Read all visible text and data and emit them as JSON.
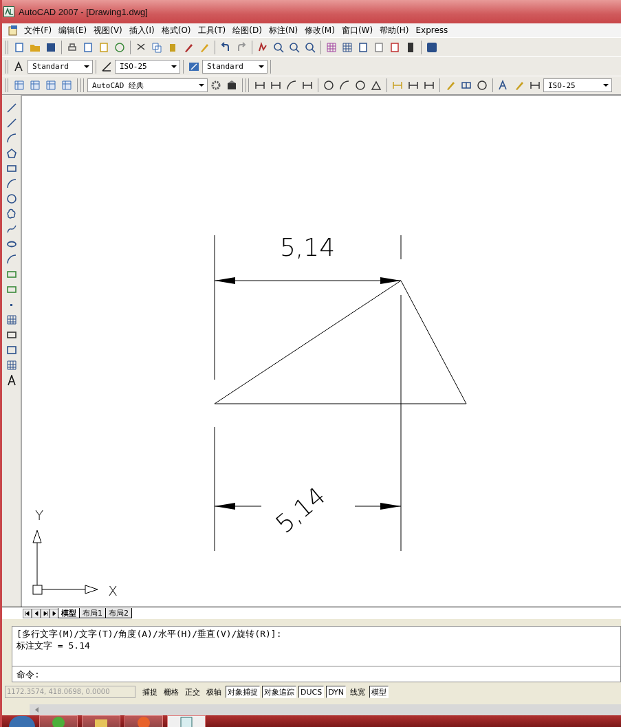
{
  "window": {
    "title": "AutoCAD 2007 - [Drawing1.dwg]"
  },
  "menu": [
    "文件(F)",
    "编辑(E)",
    "视图(V)",
    "插入(I)",
    "格式(O)",
    "工具(T)",
    "绘图(D)",
    "标注(N)",
    "修改(M)",
    "窗口(W)",
    "帮助(H)",
    "Express"
  ],
  "styles_toolbar": {
    "text_style": "Standard",
    "dim_style": "ISO-25",
    "table_style": "Standard"
  },
  "workspace_toolbar": {
    "workspace": "AutoCAD 经典",
    "dim_style": "ISO-25"
  },
  "canvas": {
    "top_dimension": "5,14",
    "bottom_dimension": "5,14",
    "axis_x": "X",
    "axis_y": "Y"
  },
  "layout_tabs": [
    {
      "label": "模型",
      "selected": true
    },
    {
      "label": "布局1",
      "selected": false
    },
    {
      "label": "布局2",
      "selected": false
    }
  ],
  "command_history": [
    "[多行文字(M)/文字(T)/角度(A)/水平(H)/垂直(V)/旋转(R)]:",
    "标注文字 = 5.14"
  ],
  "command_prompt": "命令:",
  "status_bar": {
    "coordinates": "1172.3574, 418.0698, 0.0000",
    "toggles": [
      {
        "label": "捕捉",
        "on": false
      },
      {
        "label": "栅格",
        "on": false
      },
      {
        "label": "正交",
        "on": false
      },
      {
        "label": "极轴",
        "on": false
      },
      {
        "label": "对象捕捉",
        "on": true
      },
      {
        "label": "对象追踪",
        "on": true
      },
      {
        "label": "DUCS",
        "on": true
      },
      {
        "label": "DYN",
        "on": true
      },
      {
        "label": "线宽",
        "on": false
      },
      {
        "label": "模型",
        "on": true
      }
    ]
  }
}
